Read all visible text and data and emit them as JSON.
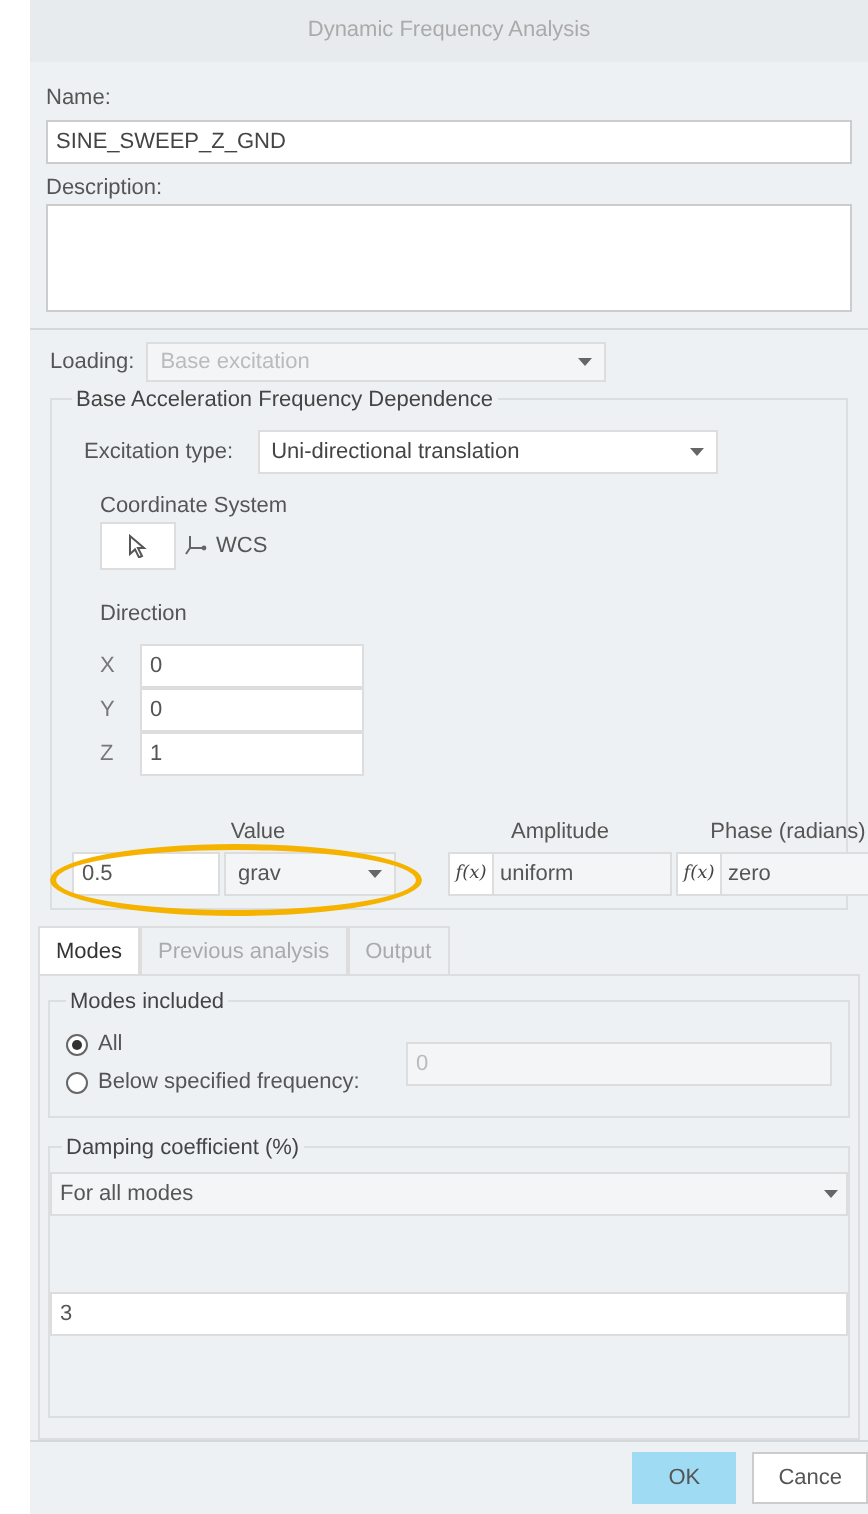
{
  "window": {
    "title": "Dynamic Frequency Analysis"
  },
  "name": {
    "label": "Name:",
    "value": "SINE_SWEEP_Z_GND"
  },
  "description": {
    "label": "Description:"
  },
  "loading": {
    "label": "Loading:",
    "value": "Base excitation",
    "disabled": true
  },
  "base_acceleration": {
    "title": "Base Acceleration Frequency Dependence",
    "excitation_type": {
      "label": "Excitation type:",
      "value": "Uni-directional translation"
    },
    "coordinate_system": {
      "label": "Coordinate System",
      "value": "WCS"
    },
    "direction": {
      "label": "Direction",
      "components": [
        {
          "axis": "X",
          "value": "0"
        },
        {
          "axis": "Y",
          "value": "0"
        },
        {
          "axis": "Z",
          "value": "1"
        }
      ]
    },
    "value": {
      "label": "Value",
      "value": "0.5",
      "unit": "grav",
      "highlighted": true
    },
    "amplitude": {
      "label": "Amplitude",
      "function": "f(x)",
      "value": "uniform"
    },
    "phase": {
      "label": "Phase (radians)",
      "function": "f(x)",
      "value": "zero"
    }
  },
  "tabs": [
    {
      "label": "Modes",
      "selected": true
    },
    {
      "label": "Previous analysis",
      "selected": false
    },
    {
      "label": "Output",
      "selected": false
    }
  ],
  "modes_included": {
    "title": "Modes included",
    "options": [
      {
        "label": "All",
        "selected": true
      },
      {
        "label": "Below specified frequency:",
        "selected": false
      }
    ],
    "frequency": {
      "value": "0",
      "disabled": true
    }
  },
  "damping": {
    "title": "Damping coefficient (%)",
    "mode": "For all modes",
    "value": "3"
  },
  "buttons": [
    {
      "label": "OK",
      "kind": "primary"
    },
    {
      "label": "Cance",
      "kind": "secondary"
    }
  ]
}
